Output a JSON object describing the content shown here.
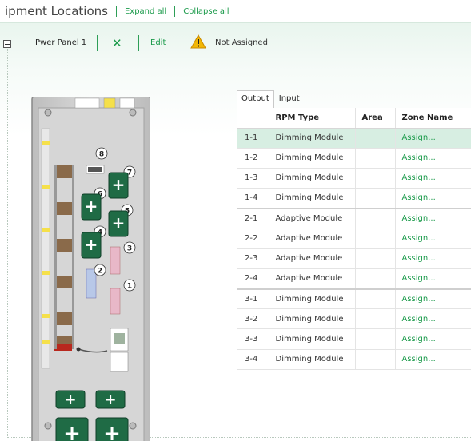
{
  "header": {
    "title": "ipment Locations",
    "expand_all": "Expand all",
    "collapse_all": "Collapse all"
  },
  "panel": {
    "name": "Pwer Panel 1",
    "remove_glyph": "✕",
    "edit_label": "Edit",
    "status": "Not Assigned"
  },
  "tabs": [
    {
      "label": "Output",
      "active": true
    },
    {
      "label": "Input",
      "active": false
    }
  ],
  "table": {
    "columns": [
      "",
      "RPM Type",
      "Area",
      "Zone Name"
    ],
    "rows": [
      {
        "output": "1-1",
        "type": "Dimming Module",
        "area": "",
        "zone": "Assign..."
      },
      {
        "output": "1-2",
        "type": "Dimming Module",
        "area": "",
        "zone": "Assign..."
      },
      {
        "output": "1-3",
        "type": "Dimming Module",
        "area": "",
        "zone": "Assign..."
      },
      {
        "output": "1-4",
        "type": "Dimming Module",
        "area": "",
        "zone": "Assign..."
      },
      {
        "output": "2-1",
        "type": "Adaptive Module",
        "area": "",
        "zone": "Assign..."
      },
      {
        "output": "2-2",
        "type": "Adaptive Module",
        "area": "",
        "zone": "Assign..."
      },
      {
        "output": "2-3",
        "type": "Adaptive Module",
        "area": "",
        "zone": "Assign..."
      },
      {
        "output": "2-4",
        "type": "Adaptive Module",
        "area": "",
        "zone": "Assign..."
      },
      {
        "output": "3-1",
        "type": "Dimming Module",
        "area": "",
        "zone": "Assign..."
      },
      {
        "output": "3-2",
        "type": "Dimming Module",
        "area": "",
        "zone": "Assign..."
      },
      {
        "output": "3-3",
        "type": "Dimming Module",
        "area": "",
        "zone": "Assign..."
      },
      {
        "output": "3-4",
        "type": "Dimming Module",
        "area": "",
        "zone": "Assign..."
      }
    ]
  },
  "enclosure": {
    "slot_numbers": [
      "8",
      "7",
      "6",
      "5",
      "4",
      "3",
      "2",
      "1"
    ],
    "add_glyph": "+"
  },
  "colors": {
    "accent": "#1a9a4a",
    "add_button": "#1f6b45",
    "selected_row": "#d7eee2",
    "warning": "#f2b705"
  },
  "icons": {
    "collapse": "minus-box-icon",
    "remove": "close-icon",
    "status": "warning-icon",
    "add": "add-slot-icon"
  }
}
